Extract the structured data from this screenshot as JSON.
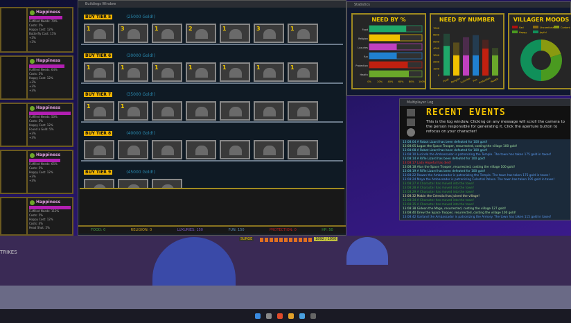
{
  "villagers": [
    {
      "label": "Happiness",
      "lines": [
        "Fulfilled Needs: 70%",
        "Costs: 5%",
        "Happy Cost: 12%",
        "Butterfly Cost: 11%",
        "+3%",
        "+3%"
      ],
      "happiness": 0.8
    },
    {
      "label": "Happiness",
      "lines": [
        "Fulfilled Needs: 64%",
        "Costs: 5%",
        "Happy Cost: 12%",
        "+3%",
        "+3%",
        "+3%"
      ],
      "happiness": 0.85
    },
    {
      "label": "Happiness",
      "lines": [
        "Fulfilled Needs: 50%",
        "Costs: 5%",
        "Happy Cost: 12%",
        "Found a Gold: 5%",
        "+3%",
        "+3%"
      ],
      "happiness": 1.0
    },
    {
      "label": "Happiness",
      "lines": [
        "Fulfilled Needs: 65%",
        "Costs: 5%",
        "Happy Cost: 12%",
        "+3%",
        "+3%"
      ],
      "happiness": 0.75
    },
    {
      "label": "Happiness",
      "lines": [
        "Fulfilled Needs: 112%",
        "Costs: 5%",
        "Happy Cost: 12%",
        "Costs: 4%",
        "Head Shot: 5%"
      ],
      "happiness": 1.0
    }
  ],
  "build": {
    "title": "Buildings Window",
    "tiers": [
      {
        "label": "BUY TIER 5",
        "cost": "(25000 Gold!)",
        "counts": [
          "1",
          "3",
          "1",
          "2",
          "1",
          "3",
          "1"
        ]
      },
      {
        "label": "BUY TIER 6",
        "cost": "(30000 Gold!)",
        "counts": [
          "1",
          "1",
          "1",
          "1",
          "1",
          "1",
          "1"
        ]
      },
      {
        "label": "BUY TIER 7",
        "cost": "(35000 Gold!)",
        "counts": [
          "1",
          "1",
          "",
          "",
          "",
          "",
          ""
        ]
      },
      {
        "label": "BUY TIER 8",
        "cost": "(40000 Gold!)",
        "counts": [
          "",
          "",
          "",
          "",
          "",
          "",
          ""
        ]
      },
      {
        "label": "BUY TIER 9",
        "cost": "(45000 Gold!)",
        "counts": [
          "",
          "",
          ""
        ]
      }
    ],
    "status": [
      {
        "text": "FOOD: 0",
        "color": "#4a9a4a"
      },
      {
        "text": "RELIGION: 0",
        "color": "#c8a020"
      },
      {
        "text": "LUXURIES: 150",
        "color": "#7a5ac8"
      },
      {
        "text": "FUN: 150",
        "color": "#5a8ab0"
      },
      {
        "text": "PROTECTION: 0",
        "color": "#c02020"
      },
      {
        "text": "HP: 50",
        "color": "#3aa03a"
      }
    ]
  },
  "stats": {
    "title": "Statistics",
    "chart_data": [
      {
        "type": "bar",
        "orientation": "horizontal",
        "title": "NEED BY %",
        "categories": [
          "Food",
          "Religion",
          "Luxuries",
          "Fun",
          "Protection",
          "Health"
        ],
        "values": [
          70,
          58,
          52,
          52,
          73,
          75
        ],
        "colors": [
          "#1fa86a",
          "#f0c000",
          "#c040c0",
          "#2080d0",
          "#c02010",
          "#6aa82a"
        ],
        "xlim": [
          0,
          100
        ],
        "ticks": [
          "0%",
          "20%",
          "40%",
          "60%",
          "80%",
          "100%"
        ]
      },
      {
        "type": "bar",
        "title": "NEED BY NUMBER",
        "categories": [
          "Food",
          "Religion",
          "Luxuries",
          "Fun",
          "Protection",
          "Health"
        ],
        "values": [
          4400,
          3000,
          3000,
          3000,
          4000,
          3000
        ],
        "totals": [
          6200,
          4900,
          5700,
          6000,
          5300,
          4100
        ],
        "ylim": [
          0,
          7000
        ],
        "ticks": [
          "0",
          "1000",
          "2000",
          "3000",
          "4000",
          "5000",
          "6000",
          "7000"
        ]
      },
      {
        "type": "pie",
        "title": "VILLAGER MOODS",
        "legend": [
          {
            "name": "Sad",
            "color": "#b01010"
          },
          {
            "name": "Uncomfortable",
            "color": "#8a6a10"
          },
          {
            "name": "Content",
            "color": "#8a9a10"
          },
          {
            "name": "Happy",
            "color": "#4a9a20"
          },
          {
            "name": "Joyful",
            "color": "#10905a"
          }
        ],
        "values": [
          0,
          0,
          20,
          30,
          50
        ]
      }
    ]
  },
  "log": {
    "window_title": "Multiplayer Log",
    "heading": "RECENT EVENTS",
    "intro": "This is the log window. Clicking on any message will scroll the camera to the person responsible for generating it. Click the aperture button to refocus on your character!",
    "entries": [
      {
        "time": "13:08:04",
        "text": "A Robot Lizard has been defeated for 100 gold!",
        "color": "#6ad0e0"
      },
      {
        "time": "13:08:05",
        "text": "Logan the Space Trooper, resurrected, costing the village 100 gold!",
        "color": "#a0e0a0"
      },
      {
        "time": "13:08:08",
        "text": "A Robot Lizard has been defeated for 100 gold!",
        "color": "#6ad0e0"
      },
      {
        "time": "13:08:10",
        "text": "Lucinda the Ambassador is patronizing the Temple. The town has taken 175 gold in taxes!",
        "color": "#5a9af0"
      },
      {
        "time": "13:08:14",
        "text": "A Rifle Lizard has been defeated for 100 gold!",
        "color": "#6ad0e0"
      },
      {
        "time": "13:08:17",
        "text": "Lady Hopeful has died!",
        "color": "#f03030"
      },
      {
        "time": "13:08:18",
        "text": "Alan the Space Trooper, resurrected, costing the village 100 gold!",
        "color": "#a0e0a0"
      },
      {
        "time": "13:08:19",
        "text": "A Rifle Lizard has been defeated for 100 gold!",
        "color": "#6ad0e0"
      },
      {
        "time": "13:08:22",
        "text": "Rowan the Ambassador is patronizing the Temple. The town has taken 175 gold in taxes!",
        "color": "#5a9af0"
      },
      {
        "time": "13:08:24",
        "text": "Maya the Ambassador is patronizing Celestial Palace. The town has taken 195 gold in taxes!",
        "color": "#5a9af0"
      },
      {
        "time": "13:08:27",
        "text": "A Character has moved into the town!",
        "color": "#3a9a3a"
      },
      {
        "time": "13:08:28",
        "text": "A Character has moved into the town!",
        "color": "#3a9a3a"
      },
      {
        "time": "13:08:29",
        "text": "A Character has moved into the town!",
        "color": "#3a9a3a"
      },
      {
        "time": "13:08:32",
        "text": "Mabin the Celestial has joined the village!",
        "color": "#e0e0a0"
      },
      {
        "time": "13:08:34",
        "text": "A Character has moved into the town!",
        "color": "#3a9a3a"
      },
      {
        "time": "13:08:35",
        "text": "A Character has moved into the town!",
        "color": "#3a9a3a"
      },
      {
        "time": "13:08:38",
        "text": "Gideon the Mage, resurrected, costing the village 127 gold!",
        "color": "#a0e0a0"
      },
      {
        "time": "13:08:40",
        "text": "Drew the Space Trooper, resurrected, costing the village 100 gold!",
        "color": "#a0e0a0"
      },
      {
        "time": "13:08:42",
        "text": "Garland the Ambassador is patronizing the Armory. The town has taken 115 gold in taxes!",
        "color": "#5a9af0"
      }
    ]
  },
  "game": {
    "hud_label": "SURGE",
    "hp_readout": "1892 / 1950",
    "sign": "TRIKES"
  }
}
